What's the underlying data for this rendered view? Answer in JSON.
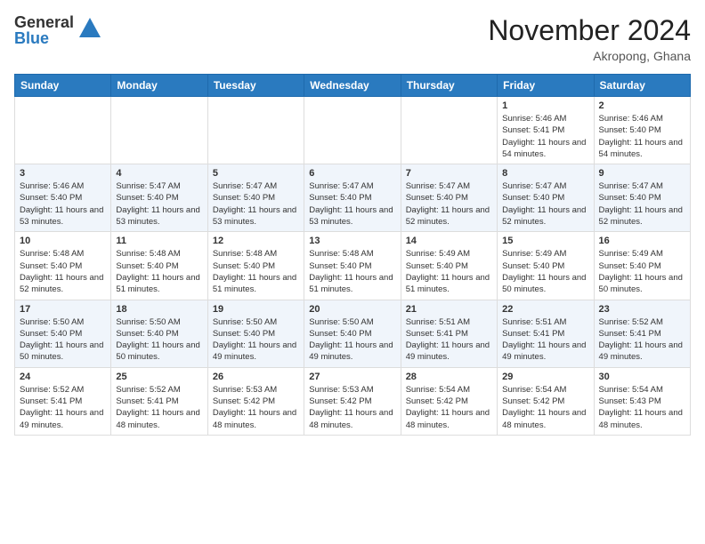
{
  "logo": {
    "general": "General",
    "blue": "Blue"
  },
  "title": {
    "month": "November 2024",
    "location": "Akropong, Ghana"
  },
  "header_days": [
    "Sunday",
    "Monday",
    "Tuesday",
    "Wednesday",
    "Thursday",
    "Friday",
    "Saturday"
  ],
  "weeks": [
    [
      {
        "day": "",
        "detail": ""
      },
      {
        "day": "",
        "detail": ""
      },
      {
        "day": "",
        "detail": ""
      },
      {
        "day": "",
        "detail": ""
      },
      {
        "day": "",
        "detail": ""
      },
      {
        "day": "1",
        "detail": "Sunrise: 5:46 AM\nSunset: 5:41 PM\nDaylight: 11 hours\nand 54 minutes."
      },
      {
        "day": "2",
        "detail": "Sunrise: 5:46 AM\nSunset: 5:40 PM\nDaylight: 11 hours\nand 54 minutes."
      }
    ],
    [
      {
        "day": "3",
        "detail": "Sunrise: 5:46 AM\nSunset: 5:40 PM\nDaylight: 11 hours\nand 53 minutes."
      },
      {
        "day": "4",
        "detail": "Sunrise: 5:47 AM\nSunset: 5:40 PM\nDaylight: 11 hours\nand 53 minutes."
      },
      {
        "day": "5",
        "detail": "Sunrise: 5:47 AM\nSunset: 5:40 PM\nDaylight: 11 hours\nand 53 minutes."
      },
      {
        "day": "6",
        "detail": "Sunrise: 5:47 AM\nSunset: 5:40 PM\nDaylight: 11 hours\nand 53 minutes."
      },
      {
        "day": "7",
        "detail": "Sunrise: 5:47 AM\nSunset: 5:40 PM\nDaylight: 11 hours\nand 52 minutes."
      },
      {
        "day": "8",
        "detail": "Sunrise: 5:47 AM\nSunset: 5:40 PM\nDaylight: 11 hours\nand 52 minutes."
      },
      {
        "day": "9",
        "detail": "Sunrise: 5:47 AM\nSunset: 5:40 PM\nDaylight: 11 hours\nand 52 minutes."
      }
    ],
    [
      {
        "day": "10",
        "detail": "Sunrise: 5:48 AM\nSunset: 5:40 PM\nDaylight: 11 hours\nand 52 minutes."
      },
      {
        "day": "11",
        "detail": "Sunrise: 5:48 AM\nSunset: 5:40 PM\nDaylight: 11 hours\nand 51 minutes."
      },
      {
        "day": "12",
        "detail": "Sunrise: 5:48 AM\nSunset: 5:40 PM\nDaylight: 11 hours\nand 51 minutes."
      },
      {
        "day": "13",
        "detail": "Sunrise: 5:48 AM\nSunset: 5:40 PM\nDaylight: 11 hours\nand 51 minutes."
      },
      {
        "day": "14",
        "detail": "Sunrise: 5:49 AM\nSunset: 5:40 PM\nDaylight: 11 hours\nand 51 minutes."
      },
      {
        "day": "15",
        "detail": "Sunrise: 5:49 AM\nSunset: 5:40 PM\nDaylight: 11 hours\nand 50 minutes."
      },
      {
        "day": "16",
        "detail": "Sunrise: 5:49 AM\nSunset: 5:40 PM\nDaylight: 11 hours\nand 50 minutes."
      }
    ],
    [
      {
        "day": "17",
        "detail": "Sunrise: 5:50 AM\nSunset: 5:40 PM\nDaylight: 11 hours\nand 50 minutes."
      },
      {
        "day": "18",
        "detail": "Sunrise: 5:50 AM\nSunset: 5:40 PM\nDaylight: 11 hours\nand 50 minutes."
      },
      {
        "day": "19",
        "detail": "Sunrise: 5:50 AM\nSunset: 5:40 PM\nDaylight: 11 hours\nand 49 minutes."
      },
      {
        "day": "20",
        "detail": "Sunrise: 5:50 AM\nSunset: 5:40 PM\nDaylight: 11 hours\nand 49 minutes."
      },
      {
        "day": "21",
        "detail": "Sunrise: 5:51 AM\nSunset: 5:41 PM\nDaylight: 11 hours\nand 49 minutes."
      },
      {
        "day": "22",
        "detail": "Sunrise: 5:51 AM\nSunset: 5:41 PM\nDaylight: 11 hours\nand 49 minutes."
      },
      {
        "day": "23",
        "detail": "Sunrise: 5:52 AM\nSunset: 5:41 PM\nDaylight: 11 hours\nand 49 minutes."
      }
    ],
    [
      {
        "day": "24",
        "detail": "Sunrise: 5:52 AM\nSunset: 5:41 PM\nDaylight: 11 hours\nand 49 minutes."
      },
      {
        "day": "25",
        "detail": "Sunrise: 5:52 AM\nSunset: 5:41 PM\nDaylight: 11 hours\nand 48 minutes."
      },
      {
        "day": "26",
        "detail": "Sunrise: 5:53 AM\nSunset: 5:42 PM\nDaylight: 11 hours\nand 48 minutes."
      },
      {
        "day": "27",
        "detail": "Sunrise: 5:53 AM\nSunset: 5:42 PM\nDaylight: 11 hours\nand 48 minutes."
      },
      {
        "day": "28",
        "detail": "Sunrise: 5:54 AM\nSunset: 5:42 PM\nDaylight: 11 hours\nand 48 minutes."
      },
      {
        "day": "29",
        "detail": "Sunrise: 5:54 AM\nSunset: 5:42 PM\nDaylight: 11 hours\nand 48 minutes."
      },
      {
        "day": "30",
        "detail": "Sunrise: 5:54 AM\nSunset: 5:43 PM\nDaylight: 11 hours\nand 48 minutes."
      }
    ]
  ]
}
